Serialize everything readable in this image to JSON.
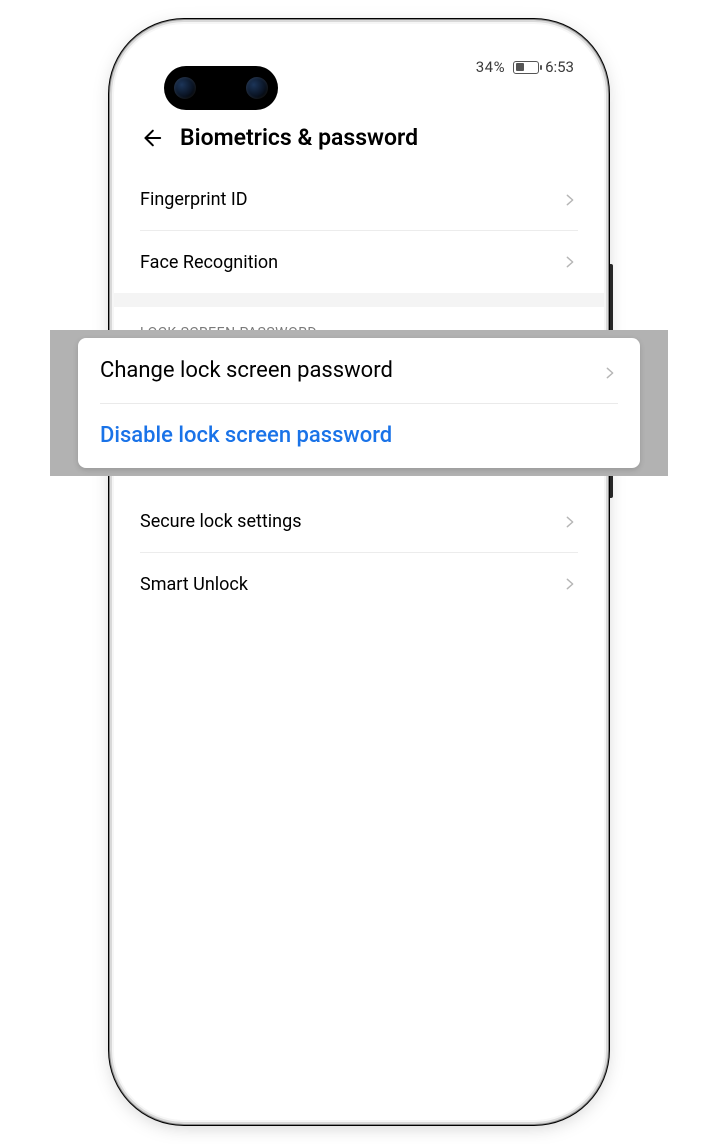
{
  "status_bar": {
    "battery_percent": "34%",
    "time": "6:53"
  },
  "header": {
    "title": "Biometrics & password"
  },
  "rows": {
    "fingerprint": "Fingerprint ID",
    "face": "Face Recognition",
    "secure_lock": "Secure lock settings",
    "smart_unlock": "Smart Unlock"
  },
  "section_header": "LOCK SCREEN PASSWORD",
  "callout": {
    "change": "Change lock screen password",
    "disable": "Disable lock screen password"
  }
}
